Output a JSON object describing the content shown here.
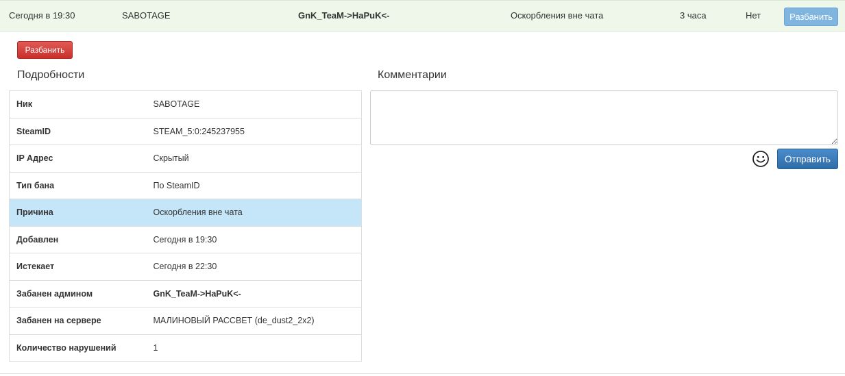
{
  "summary_row": {
    "date": "Сегодня в 19:30",
    "nick": "SABOTAGE",
    "admin": "GnK_TeaM->HaPuK<-",
    "reason": "Оскорбления вне чата",
    "duration": "3 часа",
    "status": "Нет",
    "unban_label": "Разбанить"
  },
  "unban_button_label": "Разбанить",
  "details": {
    "title": "Подробности",
    "rows": [
      {
        "key": "Ник",
        "value": "SABOTAGE"
      },
      {
        "key": "SteamID",
        "value": "STEAM_5:0:245237955"
      },
      {
        "key": "IP Адрес",
        "value": "Скрытый"
      },
      {
        "key": "Тип бана",
        "value": "По SteamID"
      },
      {
        "key": "Причина",
        "value": "Оскорбления вне чата"
      },
      {
        "key": "Добавлен",
        "value": "Сегодня в 19:30"
      },
      {
        "key": "Истекает",
        "value": "Сегодня в 22:30"
      },
      {
        "key": "Забанен админом",
        "value": "GnK_TeaM->HaPuK<-"
      },
      {
        "key": "Забанен на сервере",
        "value": "МАЛИНОВЫЙ РАССВЕТ (de_dust2_2x2)"
      },
      {
        "key": "Количество нарушений",
        "value": "1"
      }
    ]
  },
  "comments": {
    "title": "Комментарии",
    "textarea_value": "",
    "send_label": "Отправить",
    "emoji_icon": "smiley-icon"
  },
  "colors": {
    "row_bg": "#eef7e9",
    "highlight_row": "#c5e6f9",
    "unban_red": "#c9302c",
    "send_blue": "#2f6da8"
  }
}
